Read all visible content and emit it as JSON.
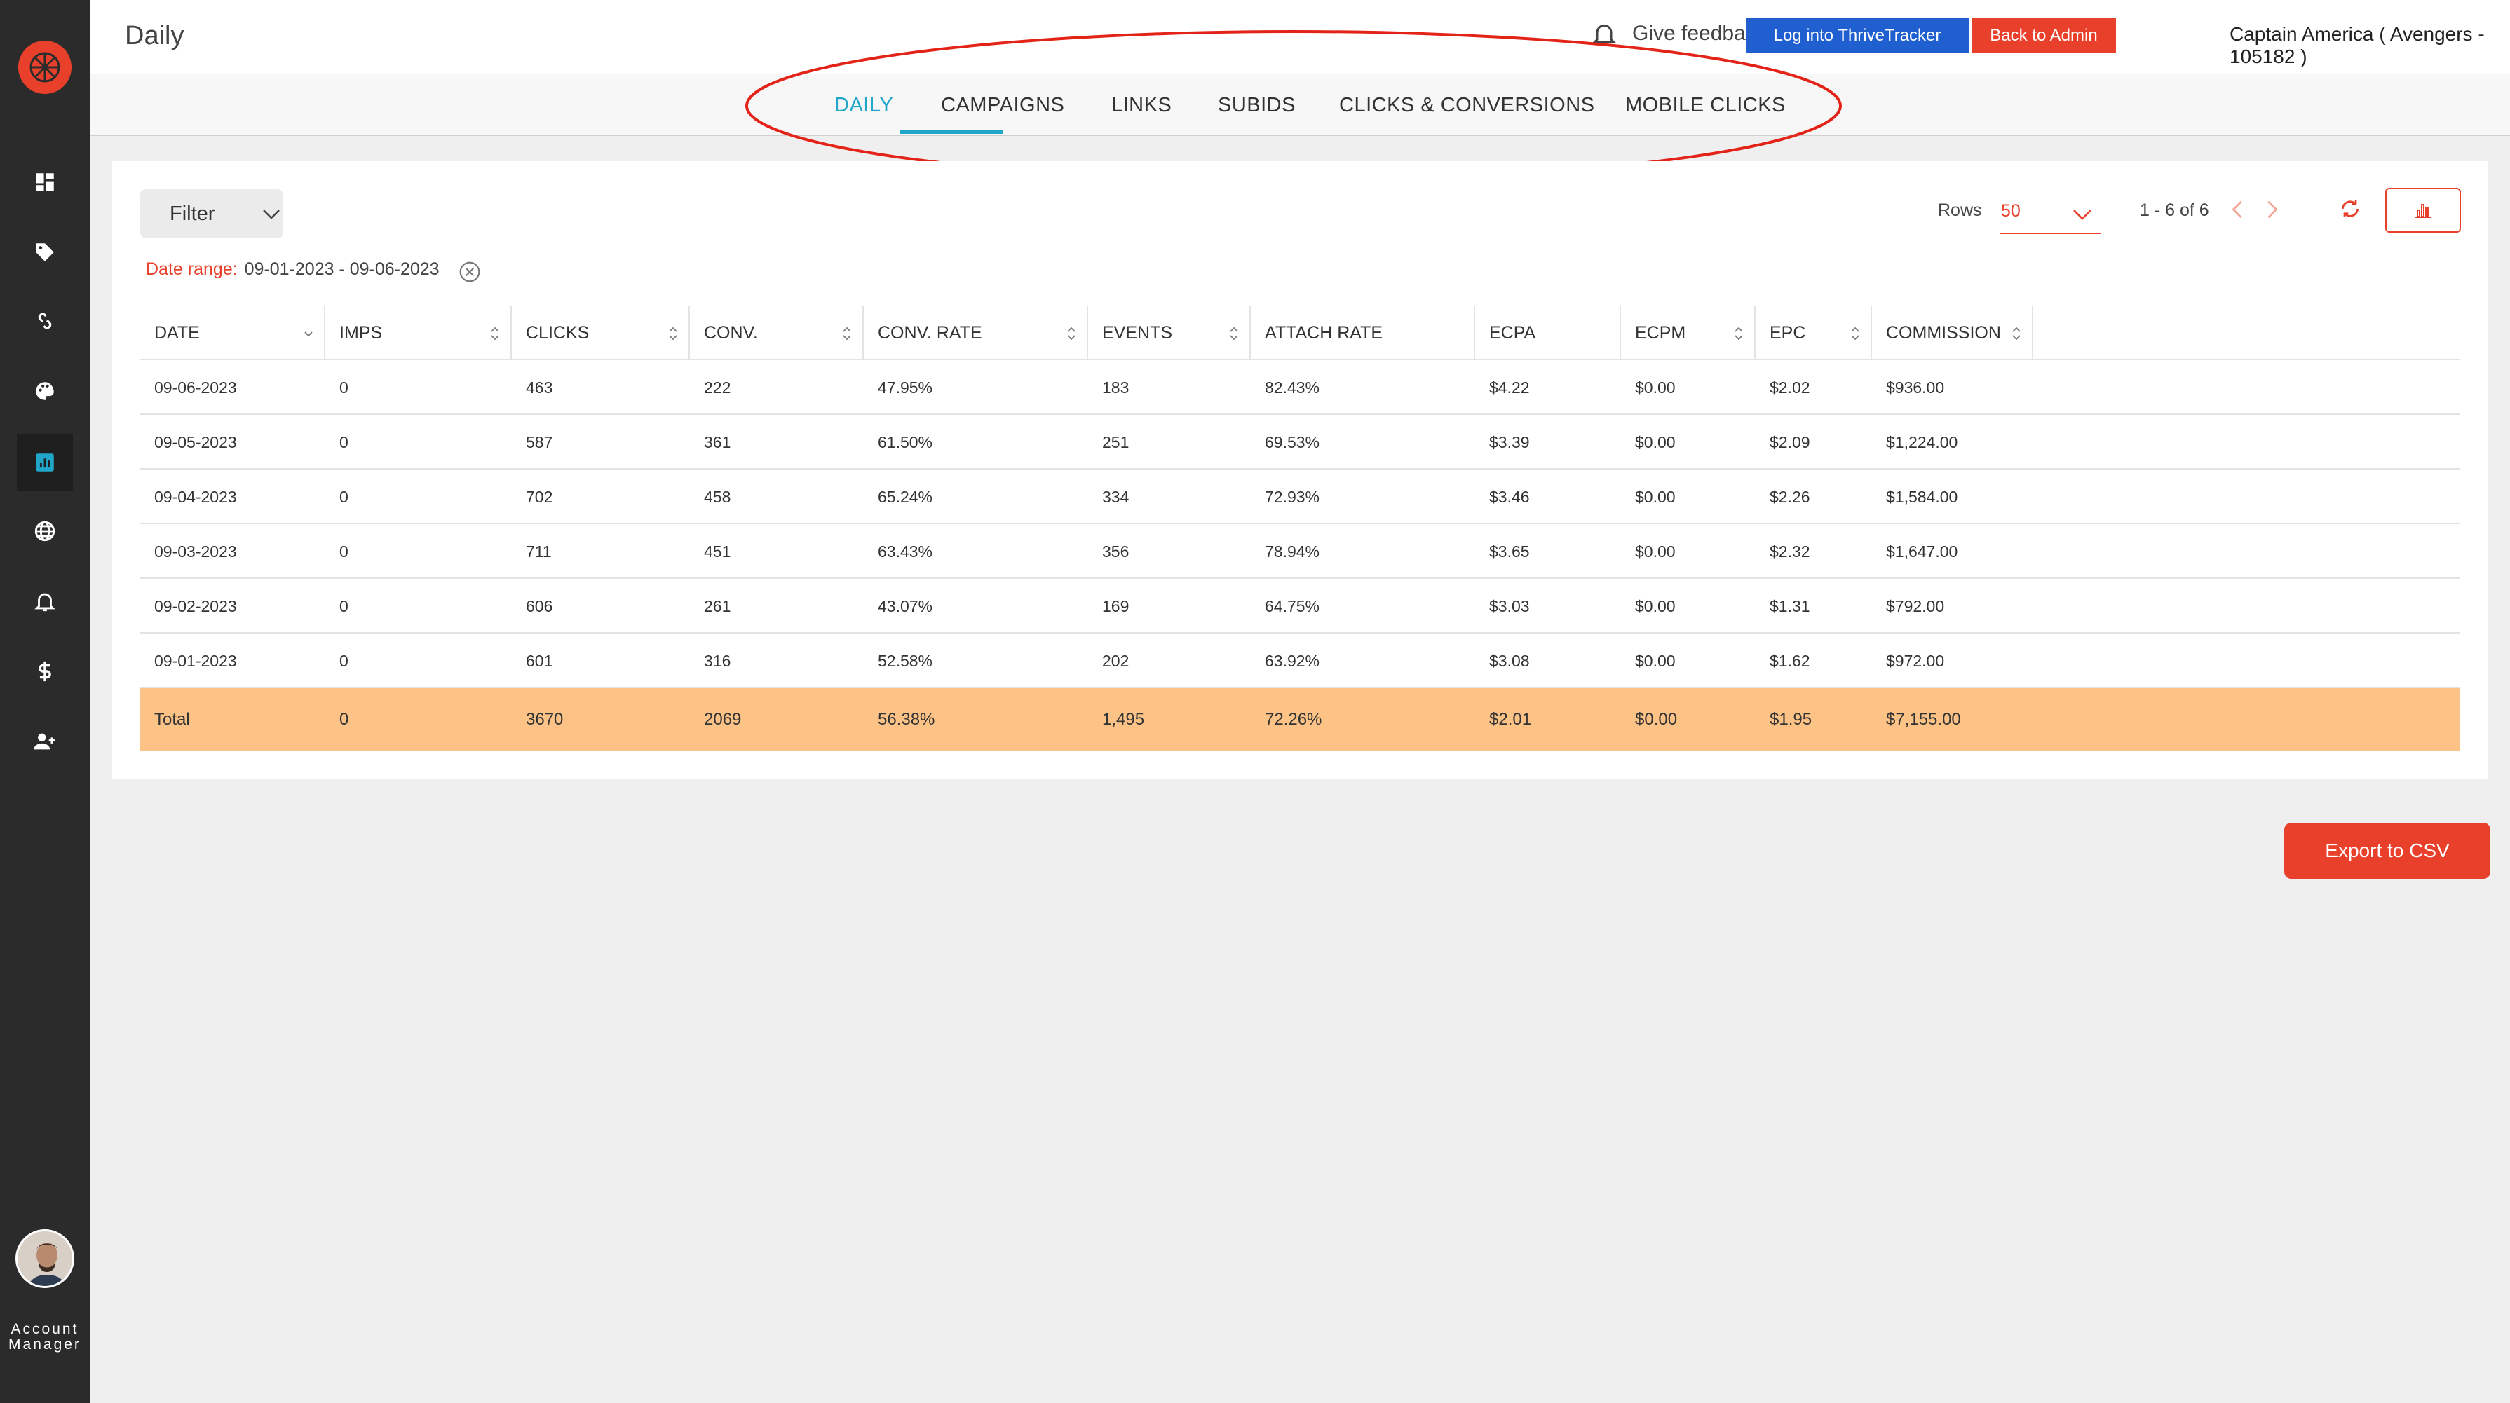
{
  "sidebar": {
    "items": [
      {
        "name": "dashboard-icon"
      },
      {
        "name": "tag-icon"
      },
      {
        "name": "link-icon"
      },
      {
        "name": "palette-icon"
      },
      {
        "name": "reports-icon",
        "active": true
      },
      {
        "name": "globe-icon"
      },
      {
        "name": "bell-icon"
      },
      {
        "name": "dollar-icon"
      },
      {
        "name": "add-user-icon"
      }
    ],
    "account_label_line1": "Account",
    "account_label_line2": "Manager"
  },
  "header": {
    "title": "Daily",
    "feedback_label": "Give feedback",
    "thrive_button": "Log into ThriveTracker",
    "admin_button": "Back to Admin",
    "user": "Captain America ( Avengers - 105182 )"
  },
  "tabs": [
    {
      "label": "DAILY",
      "active": true
    },
    {
      "label": "CAMPAIGNS"
    },
    {
      "label": "LINKS"
    },
    {
      "label": "SUBIDS"
    },
    {
      "label": "CLICKS & CONVERSIONS"
    },
    {
      "label": "MOBILE CLICKS"
    }
  ],
  "toolbar": {
    "filter_label": "Filter",
    "date_range_label": "Date range:",
    "date_range_value": "09-01-2023 - 09-06-2023",
    "rows_label": "Rows",
    "rows_value": "50",
    "page_info": "1 - 6 of 6"
  },
  "table": {
    "columns": [
      "DATE",
      "IMPS",
      "CLICKS",
      "CONV.",
      "CONV. RATE",
      "EVENTS",
      "ATTACH RATE",
      "ECPA",
      "ECPM",
      "EPC",
      "COMMISSION"
    ],
    "rows": [
      [
        "09-06-2023",
        "0",
        "463",
        "222",
        "47.95%",
        "183",
        "82.43%",
        "$4.22",
        "$0.00",
        "$2.02",
        "$936.00"
      ],
      [
        "09-05-2023",
        "0",
        "587",
        "361",
        "61.50%",
        "251",
        "69.53%",
        "$3.39",
        "$0.00",
        "$2.09",
        "$1,224.00"
      ],
      [
        "09-04-2023",
        "0",
        "702",
        "458",
        "65.24%",
        "334",
        "72.93%",
        "$3.46",
        "$0.00",
        "$2.26",
        "$1,584.00"
      ],
      [
        "09-03-2023",
        "0",
        "711",
        "451",
        "63.43%",
        "356",
        "78.94%",
        "$3.65",
        "$0.00",
        "$2.32",
        "$1,647.00"
      ],
      [
        "09-02-2023",
        "0",
        "606",
        "261",
        "43.07%",
        "169",
        "64.75%",
        "$3.03",
        "$0.00",
        "$1.31",
        "$792.00"
      ],
      [
        "09-01-2023",
        "0",
        "601",
        "316",
        "52.58%",
        "202",
        "63.92%",
        "$3.08",
        "$0.00",
        "$1.62",
        "$972.00"
      ]
    ],
    "total": [
      "Total",
      "0",
      "3670",
      "2069",
      "56.38%",
      "1,495",
      "72.26%",
      "$2.01",
      "$0.00",
      "$1.95",
      "$7,155.00"
    ]
  },
  "export_label": "Export to CSV",
  "colors": {
    "accent": "#e8402a",
    "active_tab": "#20a6c9",
    "total_row": "#fcc286",
    "thrive_button": "#1f5fcf",
    "sidebar": "#2b2b2b"
  }
}
